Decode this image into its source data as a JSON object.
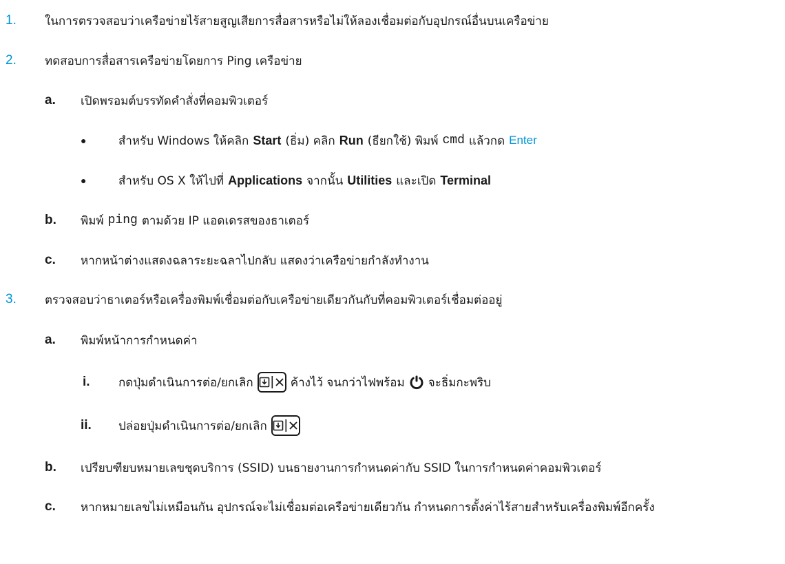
{
  "items": {
    "s1": {
      "marker": "1.",
      "text": "ในการตรวจสอบว่าเครือข่ายไร้สายสูญเสียการสื่อสารหรือไม่ให้ลองเชื่อมต่อกับอุปกรณ์อื่นบนเครือข่าย"
    },
    "s2": {
      "marker": "2.",
      "text": "ทดสอบการสื่อสารเครือข่ายโดยการ Ping เครือข่าย"
    },
    "s2a": {
      "marker": "a.",
      "text": "เปิดพรอมต์บรรทัดคำสั่งที่คอมพิวเตอร์"
    },
    "s2a_b1": {
      "marker": "●",
      "p1": "สำหรับ Windows ให้คลิก",
      "start": "Start",
      "p2": "(ธิ่ม) คลิก",
      "run": "Run",
      "p3": "(ธียกใช้) พิมพ์",
      "cmd": "cmd",
      "p4": "แล้วกด",
      "enter": "Enter"
    },
    "s2a_b2": {
      "marker": "●",
      "p1": "สำหรับ OS X ให้ไปที่",
      "applications": "Applications",
      "p2": "จากนั้น",
      "utilities": "Utilities",
      "p3": "และเปิด",
      "terminal": "Terminal"
    },
    "s2b": {
      "marker": "b.",
      "p1": "พิมพ์",
      "ping": "ping",
      "p2": "ตามด้วย IP แอดเดรสของธาเตอร์"
    },
    "s2c": {
      "marker": "c.",
      "text": "หากหน้าต่างแสดงฉลาระยะฉลาไปกลับ แสดงว่าเครือข่ายกำลังทำงาน"
    },
    "s3": {
      "marker": "3.",
      "text": "ตรวจสอบว่าธาเตอร์หรือเครื่องพิมพ์เชื่อมต่อกับเครือข่ายเดียวกันกับที่คอมพิวเตอร์เชื่อมต่ออยู่"
    },
    "s3a": {
      "marker": "a.",
      "text": "พิมพ์หน้าการกำหนดค่า"
    },
    "s3a_i": {
      "marker": "i.",
      "p1": "กดปุ่มดำเนินการต่อ/ยกเลิก",
      "p2": "ค้างไว้ จนกว่าไฟพร้อม",
      "p3": "จะธิ่มกะพริบ"
    },
    "s3a_ii": {
      "marker": "ii.",
      "p1": "ปล่อยปุ่มดำเนินการต่อ/ยกเลิก"
    },
    "s3b": {
      "marker": "b.",
      "text": "เปรียบฑียบหมายเลขชุดบริการ (SSID) บนธายงานการกำหนดค่ากับ SSID ในการกำหนดค่าคอมพิวเตอร์"
    },
    "s3c": {
      "marker": "c.",
      "text": "หากหมายเลขไม่เหมือนกัน อุปกรณ์จะไม่เชื่อมต่อเครือข่ายเดียวกัน กำหนดการตั้งค่าไร้สายสำหรับเครื่องพิมพ์อีกครั้ง"
    }
  },
  "icons": {
    "resume_cancel": "resume-cancel-button-icon",
    "power": "power-icon"
  },
  "colors": {
    "accent": "#0096d6",
    "text": "#1a1a1a"
  }
}
